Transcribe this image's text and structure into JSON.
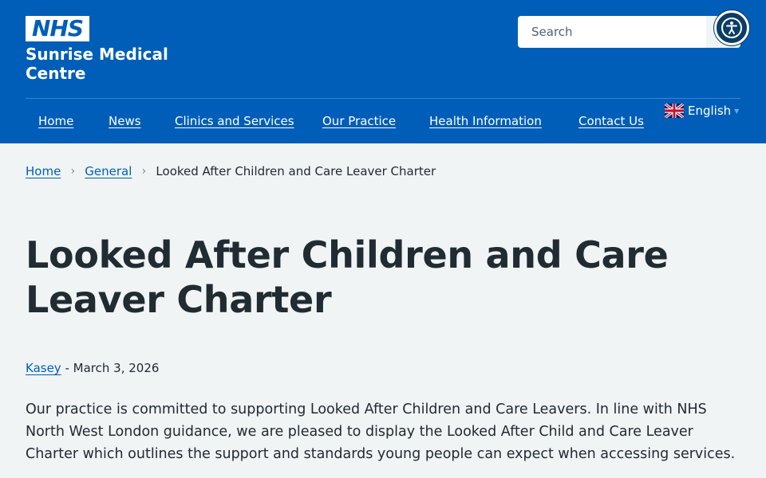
{
  "header": {
    "logo_text": "NHS",
    "org_name": "Sunrise Medical Centre",
    "search": {
      "placeholder": "Search"
    },
    "accessibility_icon": "accessibility-icon",
    "search_icon": "search-icon"
  },
  "nav": {
    "items": [
      {
        "label": "Home"
      },
      {
        "label": "News"
      },
      {
        "label": "Clinics and Services"
      },
      {
        "label": "Our Practice"
      },
      {
        "label": "Health Information"
      },
      {
        "label": "Contact Us"
      }
    ],
    "language": {
      "label": "English",
      "icon": "uk-flag-icon"
    }
  },
  "breadcrumb": {
    "items": [
      {
        "label": "Home"
      },
      {
        "label": "General"
      }
    ],
    "current": "Looked After Children and Care Leaver Charter"
  },
  "article": {
    "title": "Looked After Children and Care Leaver Charter",
    "author": "Kasey",
    "date_separator": "- ",
    "date": "March 3, 2026",
    "intro": "Our practice is committed to supporting Looked After Children and Care Leavers. In line with NHS North West London guidance, we are pleased to display the Looked After Child and Care Leaver Charter which outlines the support and standards young people can expect when accessing services."
  },
  "colors": {
    "brand_blue": "#005eb8",
    "text": "#212b32",
    "background": "#f0f4f5",
    "accessibility_button": "#0b3d66"
  }
}
